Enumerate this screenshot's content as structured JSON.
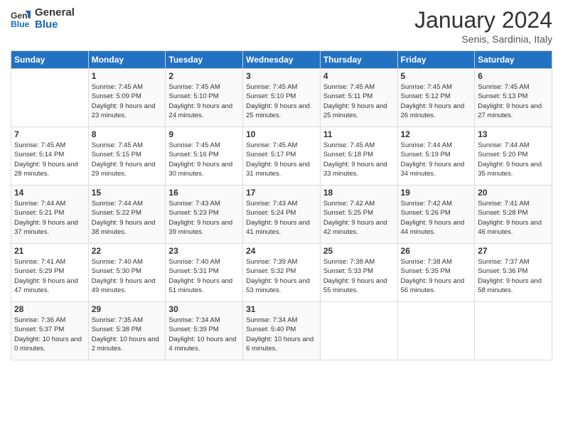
{
  "logo": {
    "line1": "General",
    "line2": "Blue"
  },
  "title": "January 2024",
  "location": "Senis, Sardinia, Italy",
  "days_of_week": [
    "Sunday",
    "Monday",
    "Tuesday",
    "Wednesday",
    "Thursday",
    "Friday",
    "Saturday"
  ],
  "weeks": [
    [
      {
        "day": "",
        "sunrise": "",
        "sunset": "",
        "daylight": ""
      },
      {
        "day": "1",
        "sunrise": "Sunrise: 7:45 AM",
        "sunset": "Sunset: 5:09 PM",
        "daylight": "Daylight: 9 hours and 23 minutes."
      },
      {
        "day": "2",
        "sunrise": "Sunrise: 7:45 AM",
        "sunset": "Sunset: 5:10 PM",
        "daylight": "Daylight: 9 hours and 24 minutes."
      },
      {
        "day": "3",
        "sunrise": "Sunrise: 7:45 AM",
        "sunset": "Sunset: 5:10 PM",
        "daylight": "Daylight: 9 hours and 25 minutes."
      },
      {
        "day": "4",
        "sunrise": "Sunrise: 7:45 AM",
        "sunset": "Sunset: 5:11 PM",
        "daylight": "Daylight: 9 hours and 25 minutes."
      },
      {
        "day": "5",
        "sunrise": "Sunrise: 7:45 AM",
        "sunset": "Sunset: 5:12 PM",
        "daylight": "Daylight: 9 hours and 26 minutes."
      },
      {
        "day": "6",
        "sunrise": "Sunrise: 7:45 AM",
        "sunset": "Sunset: 5:13 PM",
        "daylight": "Daylight: 9 hours and 27 minutes."
      }
    ],
    [
      {
        "day": "7",
        "sunrise": "Sunrise: 7:45 AM",
        "sunset": "Sunset: 5:14 PM",
        "daylight": "Daylight: 9 hours and 28 minutes."
      },
      {
        "day": "8",
        "sunrise": "Sunrise: 7:45 AM",
        "sunset": "Sunset: 5:15 PM",
        "daylight": "Daylight: 9 hours and 29 minutes."
      },
      {
        "day": "9",
        "sunrise": "Sunrise: 7:45 AM",
        "sunset": "Sunset: 5:16 PM",
        "daylight": "Daylight: 9 hours and 30 minutes."
      },
      {
        "day": "10",
        "sunrise": "Sunrise: 7:45 AM",
        "sunset": "Sunset: 5:17 PM",
        "daylight": "Daylight: 9 hours and 31 minutes."
      },
      {
        "day": "11",
        "sunrise": "Sunrise: 7:45 AM",
        "sunset": "Sunset: 5:18 PM",
        "daylight": "Daylight: 9 hours and 33 minutes."
      },
      {
        "day": "12",
        "sunrise": "Sunrise: 7:44 AM",
        "sunset": "Sunset: 5:19 PM",
        "daylight": "Daylight: 9 hours and 34 minutes."
      },
      {
        "day": "13",
        "sunrise": "Sunrise: 7:44 AM",
        "sunset": "Sunset: 5:20 PM",
        "daylight": "Daylight: 9 hours and 35 minutes."
      }
    ],
    [
      {
        "day": "14",
        "sunrise": "Sunrise: 7:44 AM",
        "sunset": "Sunset: 5:21 PM",
        "daylight": "Daylight: 9 hours and 37 minutes."
      },
      {
        "day": "15",
        "sunrise": "Sunrise: 7:44 AM",
        "sunset": "Sunset: 5:22 PM",
        "daylight": "Daylight: 9 hours and 38 minutes."
      },
      {
        "day": "16",
        "sunrise": "Sunrise: 7:43 AM",
        "sunset": "Sunset: 5:23 PM",
        "daylight": "Daylight: 9 hours and 39 minutes."
      },
      {
        "day": "17",
        "sunrise": "Sunrise: 7:43 AM",
        "sunset": "Sunset: 5:24 PM",
        "daylight": "Daylight: 9 hours and 41 minutes."
      },
      {
        "day": "18",
        "sunrise": "Sunrise: 7:42 AM",
        "sunset": "Sunset: 5:25 PM",
        "daylight": "Daylight: 9 hours and 42 minutes."
      },
      {
        "day": "19",
        "sunrise": "Sunrise: 7:42 AM",
        "sunset": "Sunset: 5:26 PM",
        "daylight": "Daylight: 9 hours and 44 minutes."
      },
      {
        "day": "20",
        "sunrise": "Sunrise: 7:41 AM",
        "sunset": "Sunset: 5:28 PM",
        "daylight": "Daylight: 9 hours and 46 minutes."
      }
    ],
    [
      {
        "day": "21",
        "sunrise": "Sunrise: 7:41 AM",
        "sunset": "Sunset: 5:29 PM",
        "daylight": "Daylight: 9 hours and 47 minutes."
      },
      {
        "day": "22",
        "sunrise": "Sunrise: 7:40 AM",
        "sunset": "Sunset: 5:30 PM",
        "daylight": "Daylight: 9 hours and 49 minutes."
      },
      {
        "day": "23",
        "sunrise": "Sunrise: 7:40 AM",
        "sunset": "Sunset: 5:31 PM",
        "daylight": "Daylight: 9 hours and 51 minutes."
      },
      {
        "day": "24",
        "sunrise": "Sunrise: 7:39 AM",
        "sunset": "Sunset: 5:32 PM",
        "daylight": "Daylight: 9 hours and 53 minutes."
      },
      {
        "day": "25",
        "sunrise": "Sunrise: 7:38 AM",
        "sunset": "Sunset: 5:33 PM",
        "daylight": "Daylight: 9 hours and 55 minutes."
      },
      {
        "day": "26",
        "sunrise": "Sunrise: 7:38 AM",
        "sunset": "Sunset: 5:35 PM",
        "daylight": "Daylight: 9 hours and 56 minutes."
      },
      {
        "day": "27",
        "sunrise": "Sunrise: 7:37 AM",
        "sunset": "Sunset: 5:36 PM",
        "daylight": "Daylight: 9 hours and 58 minutes."
      }
    ],
    [
      {
        "day": "28",
        "sunrise": "Sunrise: 7:36 AM",
        "sunset": "Sunset: 5:37 PM",
        "daylight": "Daylight: 10 hours and 0 minutes."
      },
      {
        "day": "29",
        "sunrise": "Sunrise: 7:35 AM",
        "sunset": "Sunset: 5:38 PM",
        "daylight": "Daylight: 10 hours and 2 minutes."
      },
      {
        "day": "30",
        "sunrise": "Sunrise: 7:34 AM",
        "sunset": "Sunset: 5:39 PM",
        "daylight": "Daylight: 10 hours and 4 minutes."
      },
      {
        "day": "31",
        "sunrise": "Sunrise: 7:34 AM",
        "sunset": "Sunset: 5:40 PM",
        "daylight": "Daylight: 10 hours and 6 minutes."
      },
      {
        "day": "",
        "sunrise": "",
        "sunset": "",
        "daylight": ""
      },
      {
        "day": "",
        "sunrise": "",
        "sunset": "",
        "daylight": ""
      },
      {
        "day": "",
        "sunrise": "",
        "sunset": "",
        "daylight": ""
      }
    ]
  ]
}
